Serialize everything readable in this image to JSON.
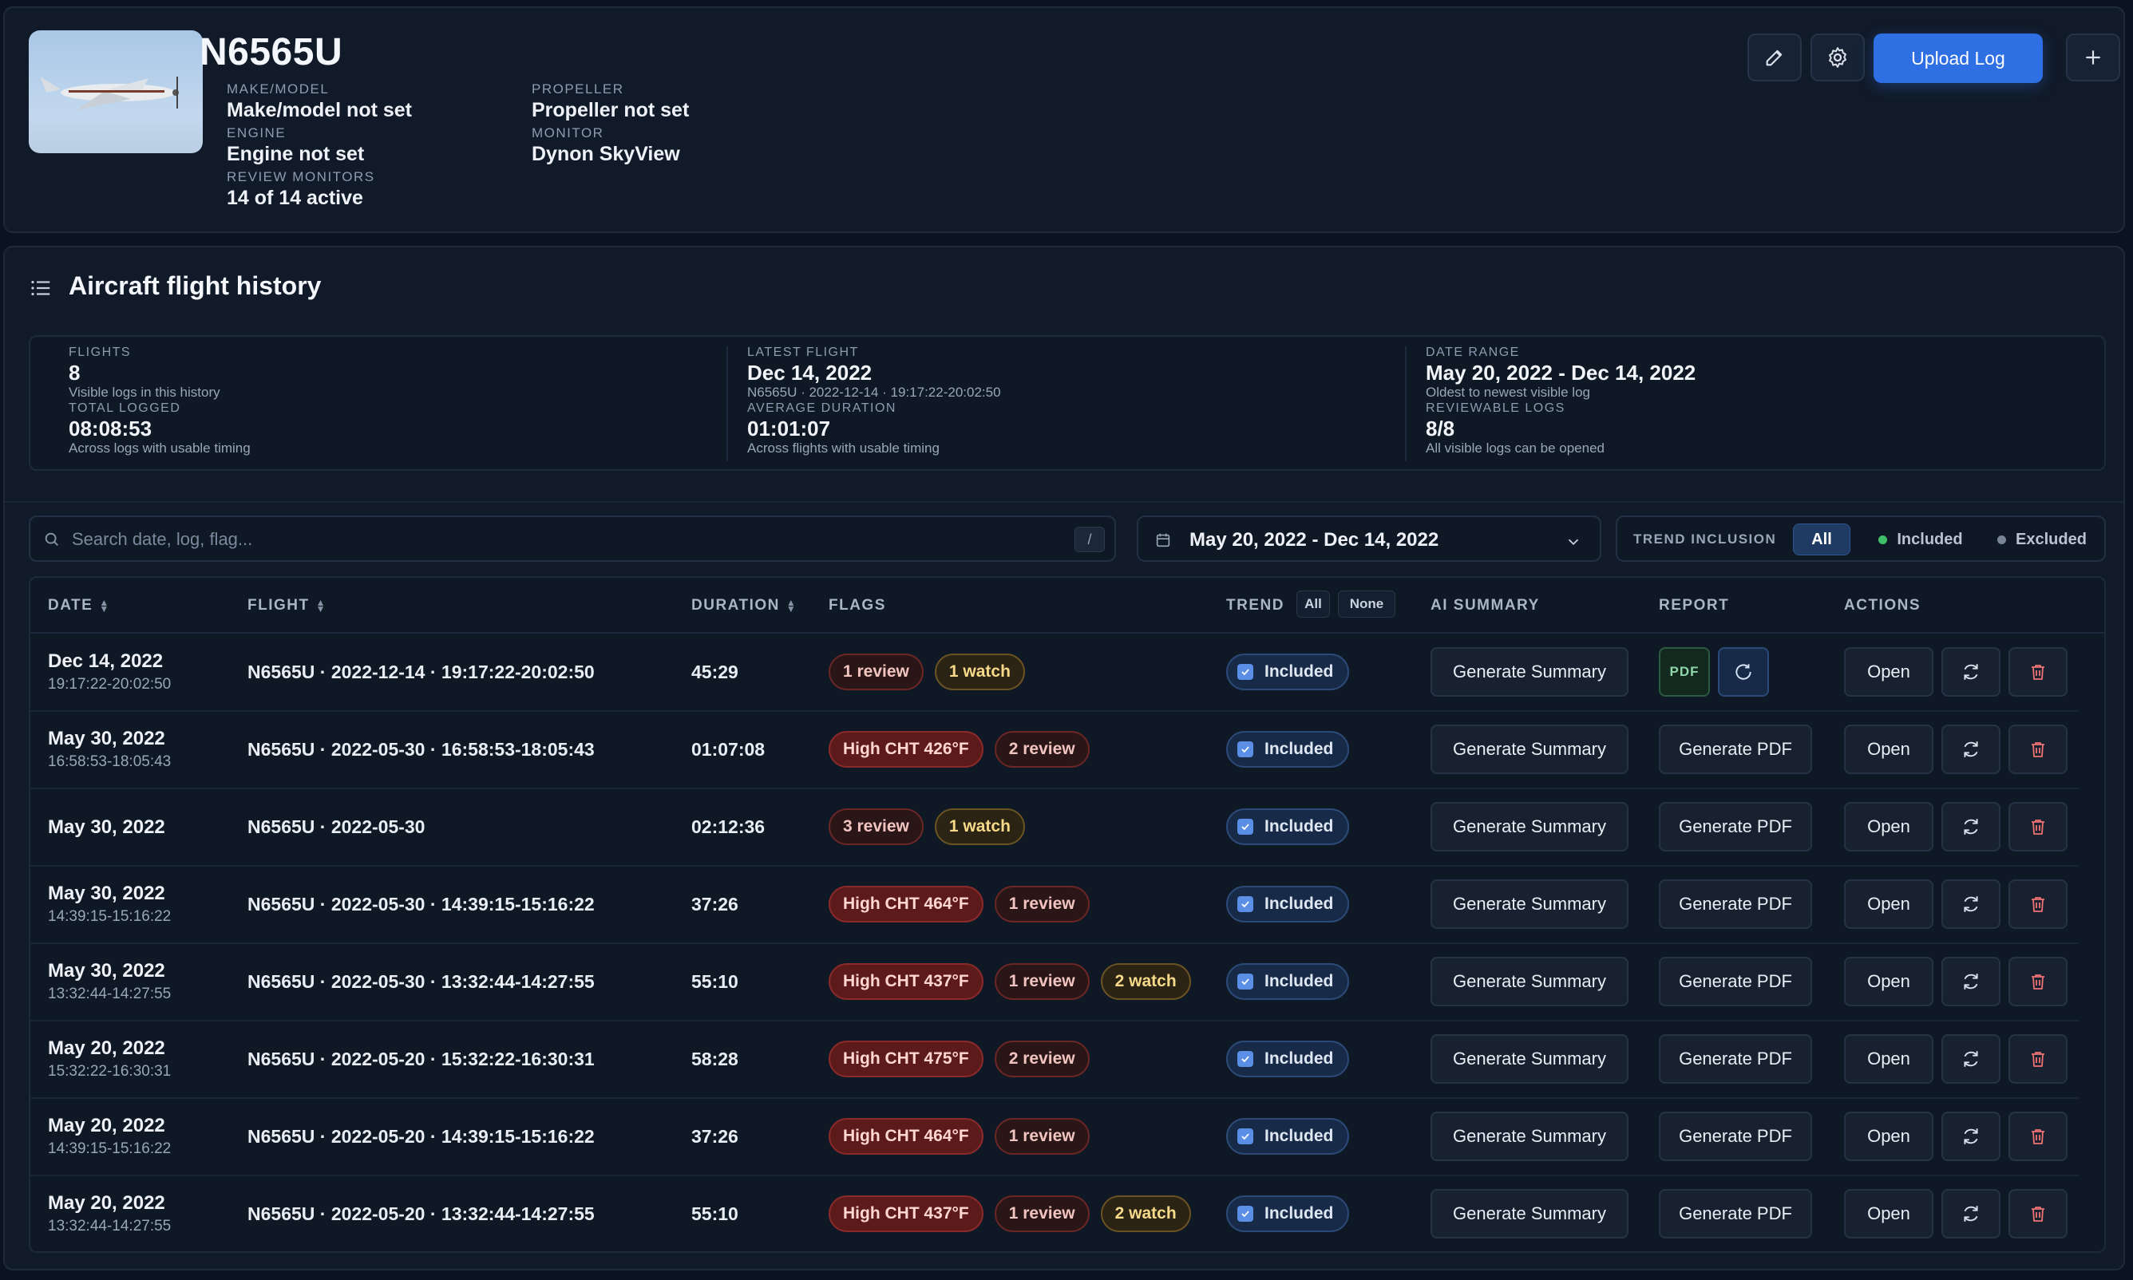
{
  "aircraft": {
    "tail_number": "N6565U",
    "specs": [
      {
        "key": "MAKE/MODEL",
        "value": "Make/model not set"
      },
      {
        "key": "ENGINE",
        "value": "Engine not set"
      },
      {
        "key": "REVIEW MONITORS",
        "value": "14 of 14 active"
      },
      {
        "key": "PROPELLER",
        "value": "Propeller not set"
      },
      {
        "key": "MONITOR",
        "value": "Dynon SkyView"
      }
    ],
    "upload_label": "Upload Log"
  },
  "history": {
    "title": "Aircraft flight history",
    "stats": [
      {
        "key": "FLIGHTS",
        "value": "8",
        "sub": "Visible logs in this history"
      },
      {
        "key": "TOTAL LOGGED",
        "value": "08:08:53",
        "sub": "Across logs with usable timing"
      },
      {
        "key": "LATEST FLIGHT",
        "value": "Dec 14, 2022",
        "sub": "N6565U · 2022-12-14 · 19:17:22-20:02:50"
      },
      {
        "key": "AVERAGE DURATION",
        "value": "01:01:07",
        "sub": "Across flights with usable timing"
      },
      {
        "key": "DATE RANGE",
        "value": "May 20, 2022 - Dec 14, 2022",
        "sub": "Oldest to newest visible log"
      },
      {
        "key": "REVIEWABLE LOGS",
        "value": "8/8",
        "sub": "All visible logs can be opened"
      }
    ],
    "search_placeholder": "Search date, log, flag...",
    "search_shortcut": "/",
    "date_range": "May 20, 2022 - Dec 14, 2022",
    "trend_inclusion": {
      "label": "TREND INCLUSION",
      "all": "All",
      "included": "Included",
      "excluded": "Excluded"
    },
    "columns": {
      "date": "DATE",
      "flight": "FLIGHT",
      "duration": "DURATION",
      "flags": "FLAGS",
      "trend": "TREND",
      "trend_all": "All",
      "trend_none": "None",
      "ai_summary": "AI SUMMARY",
      "report": "REPORT",
      "actions": "ACTIONS"
    },
    "labels": {
      "included": "Included",
      "generate_summary": "Generate Summary",
      "generate_pdf": "Generate PDF",
      "pdf": "PDF",
      "open": "Open"
    },
    "rows": [
      {
        "date": "Dec 14, 2022",
        "time": "19:17:22-20:02:50",
        "flight": "N6565U · 2022-12-14 · 19:17:22-20:02:50",
        "duration": "45:29",
        "flags": [
          {
            "type": "review",
            "text": "1 review"
          },
          {
            "type": "watch",
            "text": "1 watch"
          }
        ],
        "has_pdf": true
      },
      {
        "date": "May 30, 2022",
        "time": "16:58:53-18:05:43",
        "flight": "N6565U · 2022-05-30 · 16:58:53-18:05:43",
        "duration": "01:07:08",
        "flags": [
          {
            "type": "high",
            "text": "High CHT 426°F"
          },
          {
            "type": "review",
            "text": "2 review"
          }
        ],
        "has_pdf": false
      },
      {
        "date": "May 30, 2022",
        "time": "",
        "flight": "N6565U · 2022-05-30",
        "duration": "02:12:36",
        "flags": [
          {
            "type": "review",
            "text": "3 review"
          },
          {
            "type": "watch",
            "text": "1 watch"
          }
        ],
        "has_pdf": false
      },
      {
        "date": "May 30, 2022",
        "time": "14:39:15-15:16:22",
        "flight": "N6565U · 2022-05-30 · 14:39:15-15:16:22",
        "duration": "37:26",
        "flags": [
          {
            "type": "high",
            "text": "High CHT 464°F"
          },
          {
            "type": "review",
            "text": "1 review"
          }
        ],
        "has_pdf": false
      },
      {
        "date": "May 30, 2022",
        "time": "13:32:44-14:27:55",
        "flight": "N6565U · 2022-05-30 · 13:32:44-14:27:55",
        "duration": "55:10",
        "flags": [
          {
            "type": "high",
            "text": "High CHT 437°F"
          },
          {
            "type": "review",
            "text": "1 review"
          },
          {
            "type": "watch",
            "text": "2 watch"
          }
        ],
        "has_pdf": false
      },
      {
        "date": "May 20, 2022",
        "time": "15:32:22-16:30:31",
        "flight": "N6565U · 2022-05-20 · 15:32:22-16:30:31",
        "duration": "58:28",
        "flags": [
          {
            "type": "high",
            "text": "High CHT 475°F"
          },
          {
            "type": "review",
            "text": "2 review"
          }
        ],
        "has_pdf": false
      },
      {
        "date": "May 20, 2022",
        "time": "14:39:15-15:16:22",
        "flight": "N6565U · 2022-05-20 · 14:39:15-15:16:22",
        "duration": "37:26",
        "flags": [
          {
            "type": "high",
            "text": "High CHT 464°F"
          },
          {
            "type": "review",
            "text": "1 review"
          }
        ],
        "has_pdf": false
      },
      {
        "date": "May 20, 2022",
        "time": "13:32:44-14:27:55",
        "flight": "N6565U · 2022-05-20 · 13:32:44-14:27:55",
        "duration": "55:10",
        "flags": [
          {
            "type": "high",
            "text": "High CHT 437°F"
          },
          {
            "type": "review",
            "text": "1 review"
          },
          {
            "type": "watch",
            "text": "2 watch"
          }
        ],
        "has_pdf": false
      }
    ]
  },
  "colors": {
    "background": "#0b1320",
    "accent": "#2f6fe4",
    "included_dot": "#3fbf6a",
    "excluded_dot": "#7a8596"
  }
}
